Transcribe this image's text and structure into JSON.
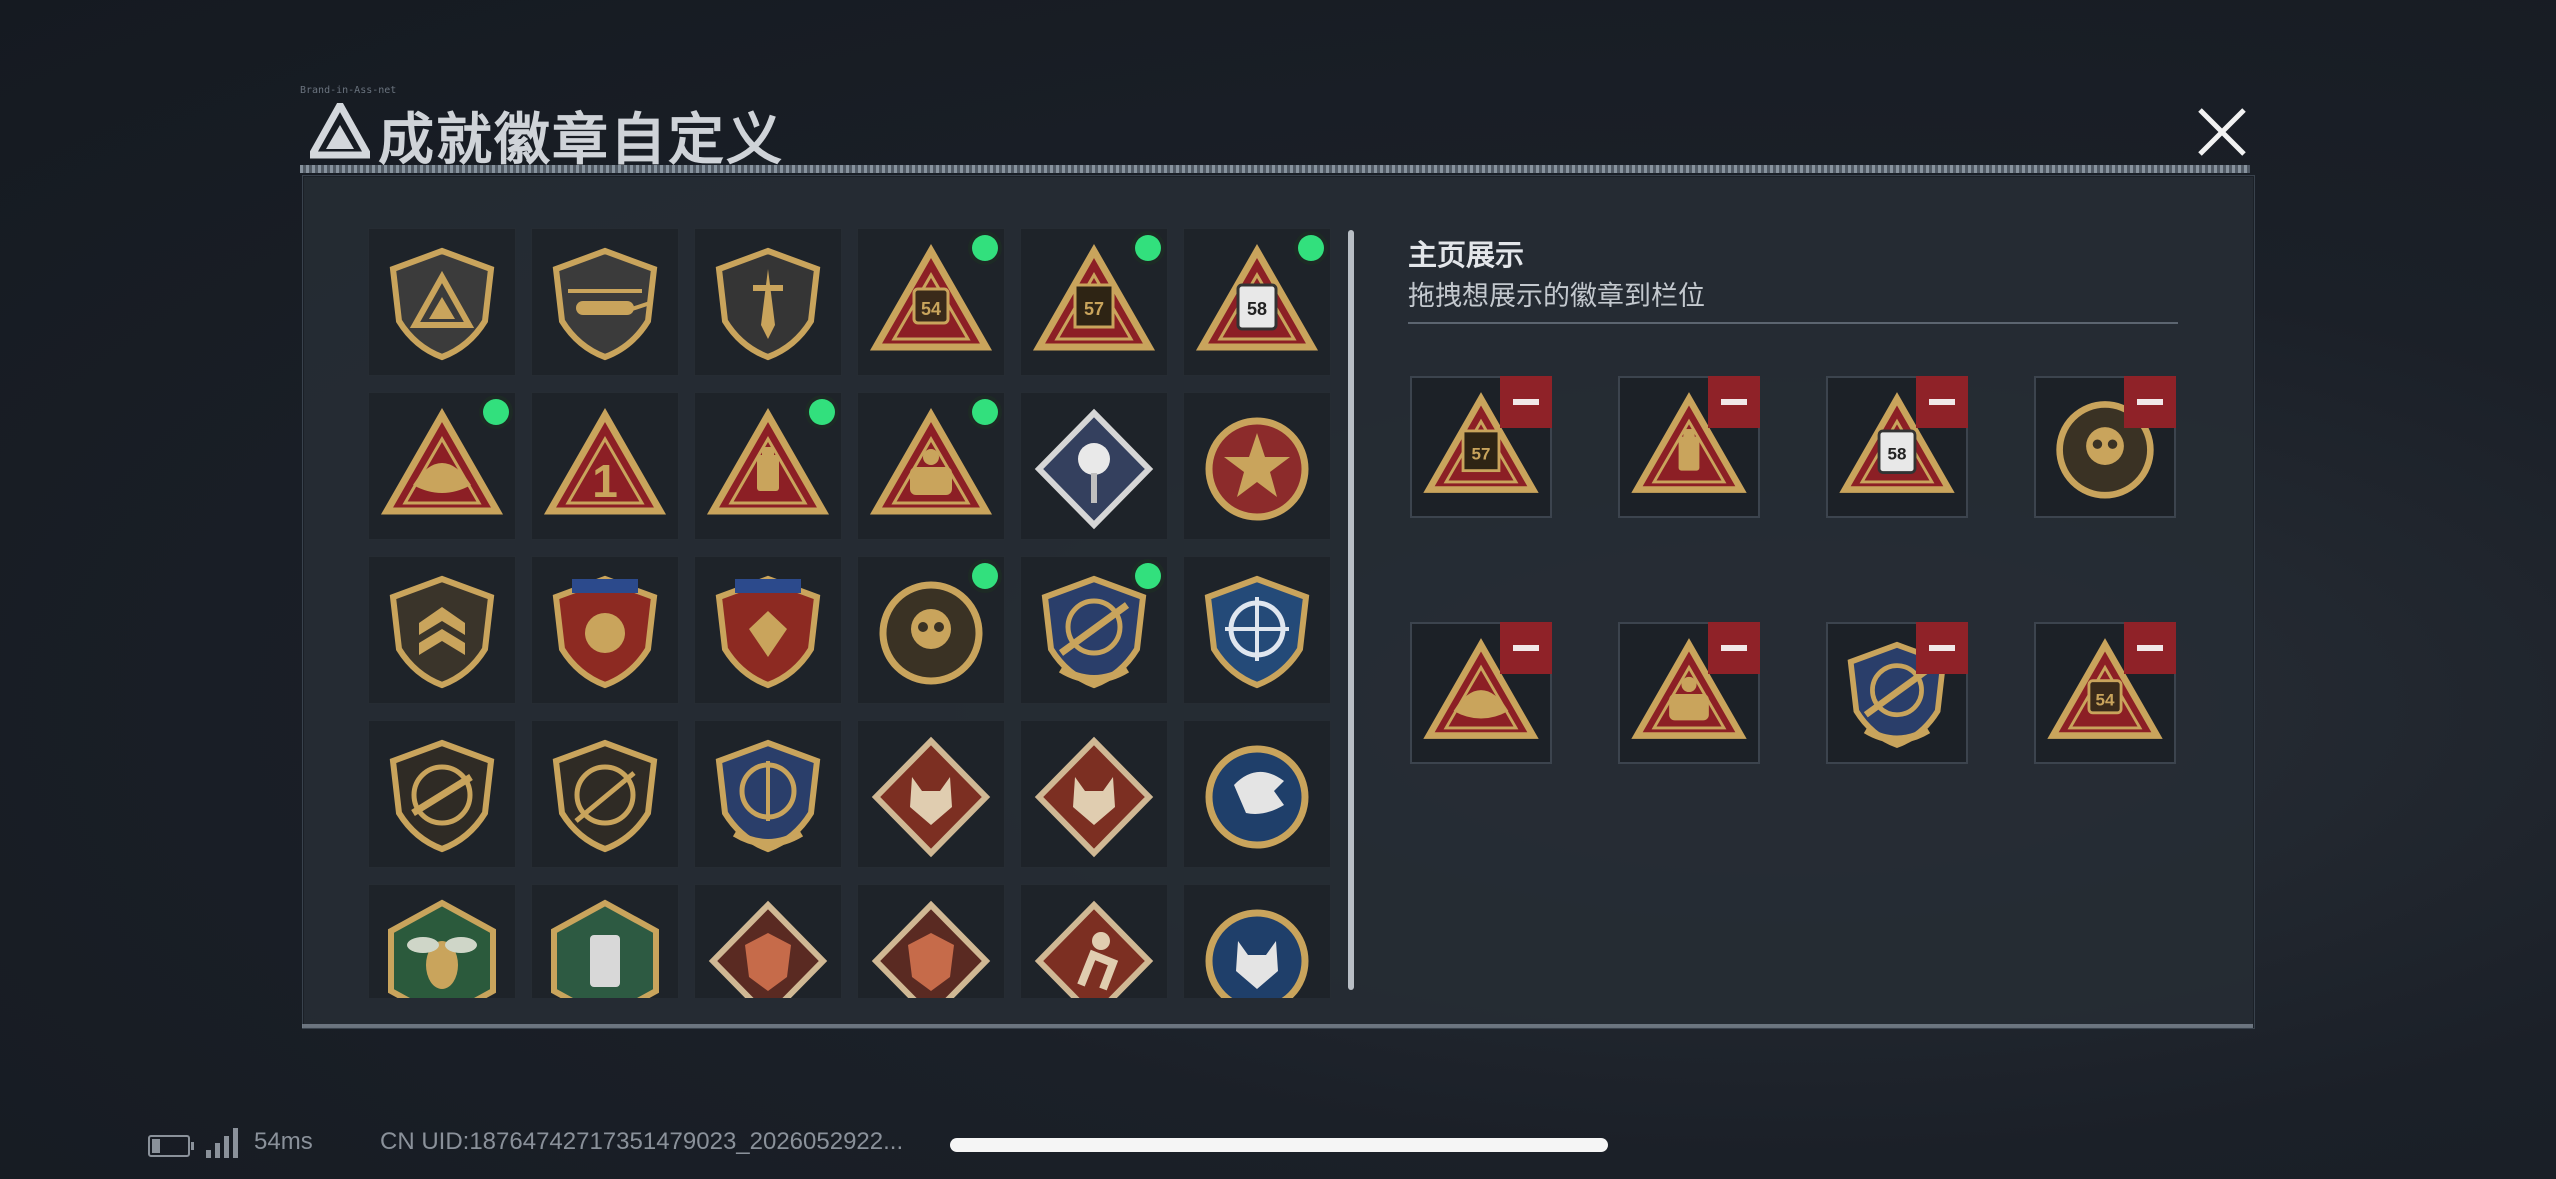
{
  "title": {
    "text": "成就徽章自定义",
    "small_text": "Brand-in-Ass-net"
  },
  "showcase": {
    "title": "主页展示",
    "subtitle": "拖拽想展示的徽章到栏位"
  },
  "status": {
    "ping": "54ms",
    "uid": "CN UID:18764742717351479023_2026052922..."
  },
  "colors": {
    "gold": "#c9a45c",
    "red": "#8c1f25",
    "blue": "#2a3e6a",
    "accent_dot": "#32e07d",
    "remove": "#8f2228"
  },
  "badges": [
    {
      "icon": "shield-logo-badge",
      "selected": false
    },
    {
      "icon": "helicopter-shield-badge",
      "selected": false
    },
    {
      "icon": "dagger-shield-badge",
      "selected": false
    },
    {
      "icon": "triangle-54-badge",
      "selected": true
    },
    {
      "icon": "triangle-57-badge",
      "selected": true
    },
    {
      "icon": "triangle-58-badge",
      "selected": true
    },
    {
      "icon": "triangle-boat-badge",
      "selected": true
    },
    {
      "icon": "triangle-1-badge",
      "selected": false
    },
    {
      "icon": "triangle-bottle-badge",
      "selected": true
    },
    {
      "icon": "triangle-squad-badge",
      "selected": true
    },
    {
      "icon": "rose-diamond-badge",
      "selected": false
    },
    {
      "icon": "star-emblem-badge",
      "selected": false
    },
    {
      "icon": "wing-shield-badge",
      "selected": false
    },
    {
      "icon": "ribbon-shield-badge",
      "selected": false
    },
    {
      "icon": "ribbon-gem-badge",
      "selected": false
    },
    {
      "icon": "round-skull-badge",
      "selected": true
    },
    {
      "icon": "crosshair-rifle-badge",
      "selected": true
    },
    {
      "icon": "blue-crosshair-badge",
      "selected": false
    },
    {
      "icon": "rifle-shield-badge",
      "selected": false
    },
    {
      "icon": "sniper-shield-badge",
      "selected": false
    },
    {
      "icon": "target-laurel-badge",
      "selected": false
    },
    {
      "icon": "wolf-diamond-badge",
      "selected": false
    },
    {
      "icon": "wolf-diamond-2-badge",
      "selected": false
    },
    {
      "icon": "eagle-circle-badge",
      "selected": false
    },
    {
      "icon": "hornet-hex-badge",
      "selected": false
    },
    {
      "icon": "green-hex-badge",
      "selected": false
    },
    {
      "icon": "dragon-badge",
      "selected": false
    },
    {
      "icon": "dragon-2-badge",
      "selected": false
    },
    {
      "icon": "runner-diamond-badge",
      "selected": false
    },
    {
      "icon": "lynx-circle-badge",
      "selected": false
    }
  ],
  "slots": [
    {
      "icon": "triangle-57-badge"
    },
    {
      "icon": "triangle-bottle-badge"
    },
    {
      "icon": "triangle-58-badge"
    },
    {
      "icon": "round-skull-badge"
    },
    {
      "icon": "triangle-boat-badge"
    },
    {
      "icon": "triangle-squad-badge"
    },
    {
      "icon": "crosshair-rifle-badge"
    },
    {
      "icon": "triangle-54-badge"
    }
  ],
  "labels": {
    "54": "54",
    "57": "57",
    "58": "58",
    "1": "1"
  }
}
